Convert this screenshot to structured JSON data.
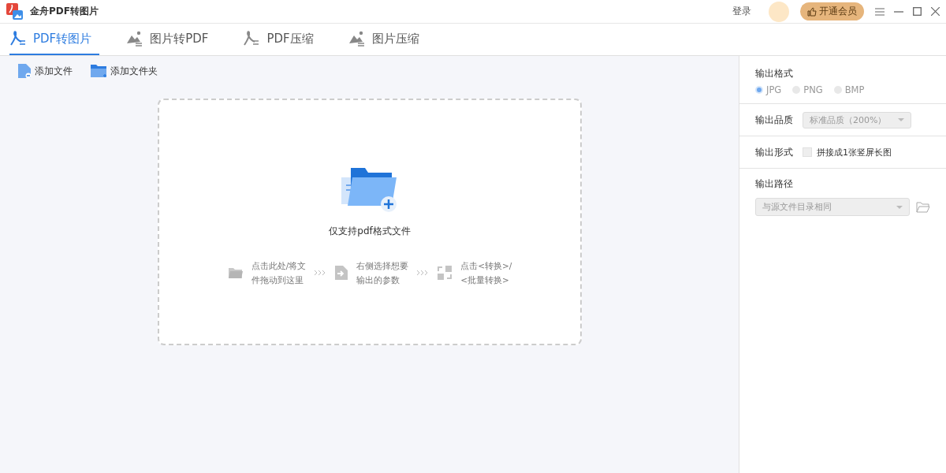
{
  "window": {
    "title": "金舟PDF转图片",
    "login": "登录",
    "vip_button": "开通会员"
  },
  "tabs": [
    {
      "label": "PDF转图片",
      "selected": true,
      "kind": "pdf"
    },
    {
      "label": "图片转PDF",
      "selected": false,
      "kind": "image"
    },
    {
      "label": "PDF压缩",
      "selected": false,
      "kind": "pdf"
    },
    {
      "label": "图片压缩",
      "selected": false,
      "kind": "image"
    }
  ],
  "toolbar": [
    {
      "label": "添加文件",
      "kind": "file"
    },
    {
      "label": "添加文件夹",
      "kind": "folder"
    }
  ],
  "drop_zone": {
    "hint": "仅支持pdf格式文件",
    "steps": [
      {
        "kind": "folder",
        "lines": [
          "点击此处/将文",
          "件拖动到这里"
        ]
      },
      {
        "kind": "import",
        "lines": [
          "右侧选择想要",
          "输出的参数"
        ]
      },
      {
        "kind": "convert",
        "lines": [
          "点击<转换>/",
          "<批量转换>"
        ]
      }
    ]
  },
  "settings": {
    "format_label": "输出格式",
    "formats": [
      {
        "label": "JPG",
        "selected": true
      },
      {
        "label": "PNG",
        "selected": false
      },
      {
        "label": "BMP",
        "selected": false
      }
    ],
    "quality_label": "输出品质",
    "quality_value": "标准品质（200%）",
    "form_label": "输出形式",
    "merge_option": {
      "label": "拼接成1张竖屏长图",
      "checked": false
    },
    "path_label": "输出路径",
    "path_value": "与源文件目录相同"
  }
}
